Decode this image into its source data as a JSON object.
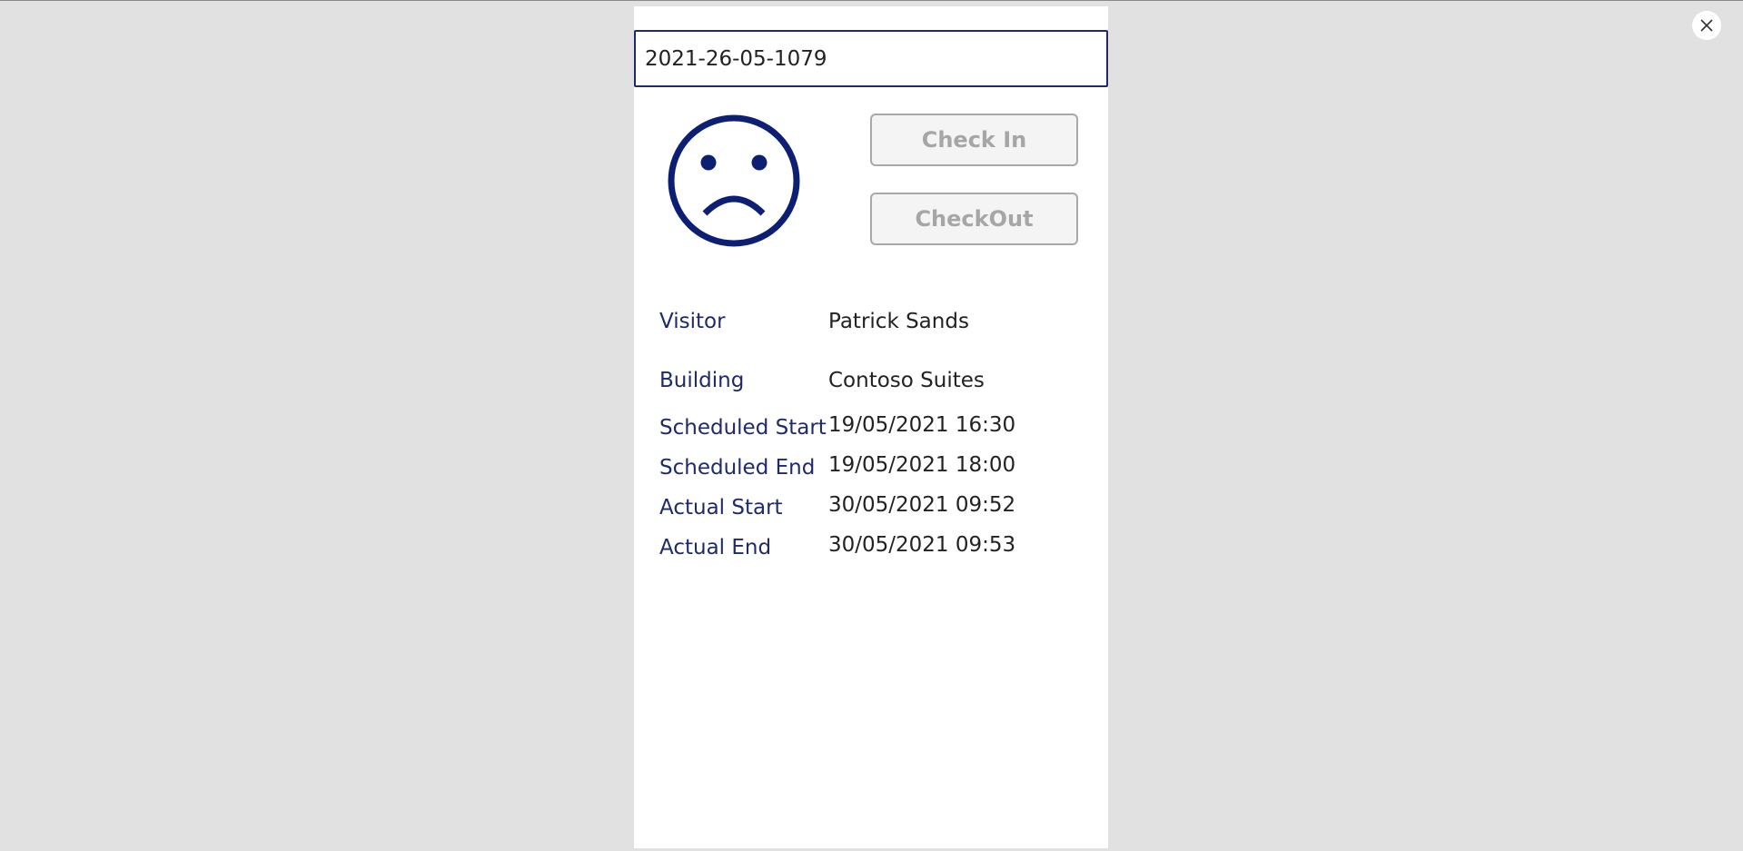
{
  "search": {
    "value": "2021-26-05-1079"
  },
  "status": {
    "icon": "sad-face-icon",
    "color": "#0d1f73"
  },
  "actions": {
    "check_in_label": "Check In",
    "check_out_label": "CheckOut"
  },
  "details": {
    "visitor_label": "Visitor",
    "visitor_value": "Patrick Sands",
    "building_label": "Building",
    "building_value": "Contoso Suites",
    "scheduled_start_label": "Scheduled Start",
    "scheduled_start_value": "19/05/2021 16:30",
    "scheduled_end_label": "Scheduled End",
    "scheduled_end_value": "19/05/2021 18:00",
    "actual_start_label": "Actual Start",
    "actual_start_value": "30/05/2021 09:52",
    "actual_end_label": "Actual End",
    "actual_end_value": "30/05/2021 09:53"
  },
  "colors": {
    "background": "#e1e1e1",
    "panel": "#ffffff",
    "accent": "#1f2a6b",
    "disabled_text": "#a6a6a6"
  }
}
